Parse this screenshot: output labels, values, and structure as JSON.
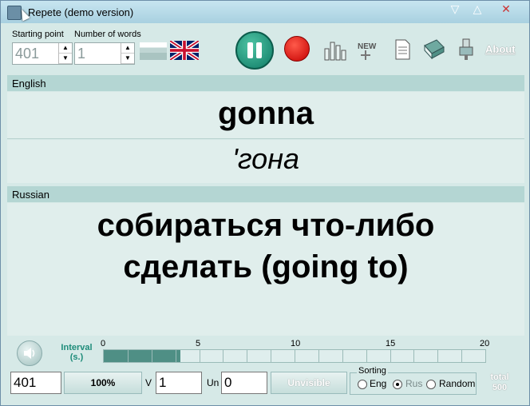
{
  "window": {
    "title": "Repete (demo version)"
  },
  "controls": {
    "starting_point_label": "Starting point",
    "number_of_words_label": "Number of words",
    "starting_point_value": "401",
    "number_of_words_value": "1",
    "about_label": "About"
  },
  "sections": {
    "english_label": "English",
    "russian_label": "Russian"
  },
  "card": {
    "word": "gonna",
    "transcription": "'гона",
    "translation_line1": "собираться что-либо",
    "translation_line2": "сделать (going to)"
  },
  "interval": {
    "label_line1": "Interval",
    "label_line2": "(s.)",
    "scale": [
      "0",
      "5",
      "10",
      "15",
      "20"
    ],
    "value_seconds": 4,
    "max_seconds": 20
  },
  "status": {
    "current_value": "401",
    "percent_label": "100%",
    "v_label": "V",
    "v_value": "1",
    "un_label": "Un",
    "un_value": "0",
    "unvisible_label": "Unvisible",
    "sorting_label": "Sorting",
    "sort_options": [
      "Eng",
      "Rus",
      "Random"
    ],
    "sort_selected": "Rus",
    "total_label": "total",
    "total_value": "500"
  },
  "colors": {
    "accent_teal": "#1e8c7a",
    "stop_red": "#d40000",
    "panel_bg": "#e0eeec",
    "label_bar": "#b4d6d3"
  }
}
